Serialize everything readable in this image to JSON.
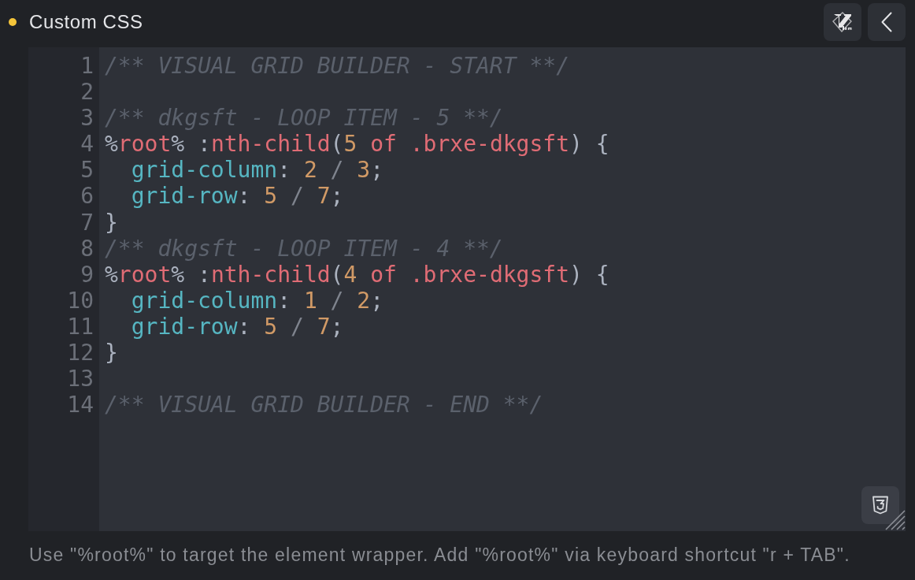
{
  "panel": {
    "title": "Custom CSS",
    "modified": true
  },
  "editor": {
    "lines": [
      {
        "number": "1",
        "tokens": [
          {
            "kind": "comment",
            "text": "/** VISUAL GRID BUILDER - START **/"
          }
        ]
      },
      {
        "number": "2"
      },
      {
        "number": "3",
        "tokens": [
          {
            "kind": "comment",
            "text": "/** dkgsft - LOOP ITEM - 5 **/"
          }
        ]
      },
      {
        "number": "4",
        "tokens": [
          {
            "kind": "plain",
            "text": "%"
          },
          {
            "kind": "keyword",
            "text": "root"
          },
          {
            "kind": "plain",
            "text": "% :"
          },
          {
            "kind": "keyword",
            "text": "nth-child"
          },
          {
            "kind": "plain",
            "text": "("
          },
          {
            "kind": "number",
            "text": "5"
          },
          {
            "kind": "keyword",
            "text": " of .brxe-dkgsft"
          },
          {
            "kind": "plain",
            "text": ") {"
          }
        ]
      },
      {
        "number": "5",
        "tokens": [
          {
            "kind": "property",
            "text": "  grid-column"
          },
          {
            "kind": "plain",
            "text": ": "
          },
          {
            "kind": "number",
            "text": "2"
          },
          {
            "kind": "operator",
            "text": " / "
          },
          {
            "kind": "number",
            "text": "3"
          },
          {
            "kind": "plain",
            "text": ";"
          }
        ]
      },
      {
        "number": "6",
        "tokens": [
          {
            "kind": "property",
            "text": "  grid-row"
          },
          {
            "kind": "plain",
            "text": ": "
          },
          {
            "kind": "number",
            "text": "5"
          },
          {
            "kind": "operator",
            "text": " / "
          },
          {
            "kind": "number",
            "text": "7"
          },
          {
            "kind": "plain",
            "text": ";"
          }
        ]
      },
      {
        "number": "7",
        "tokens": [
          {
            "kind": "plain",
            "text": "}"
          }
        ]
      },
      {
        "number": "8",
        "tokens": [
          {
            "kind": "comment",
            "text": "/** dkgsft - LOOP ITEM - 4 **/"
          }
        ]
      },
      {
        "number": "9",
        "tokens": [
          {
            "kind": "plain",
            "text": "%"
          },
          {
            "kind": "keyword",
            "text": "root"
          },
          {
            "kind": "plain",
            "text": "% :"
          },
          {
            "kind": "keyword",
            "text": "nth-child"
          },
          {
            "kind": "plain",
            "text": "("
          },
          {
            "kind": "number",
            "text": "4"
          },
          {
            "kind": "keyword",
            "text": " of .brxe-dkgsft"
          },
          {
            "kind": "plain",
            "text": ") {"
          }
        ]
      },
      {
        "number": "10",
        "tokens": [
          {
            "kind": "property",
            "text": "  grid-column"
          },
          {
            "kind": "plain",
            "text": ": "
          },
          {
            "kind": "number",
            "text": "1"
          },
          {
            "kind": "operator",
            "text": " / "
          },
          {
            "kind": "number",
            "text": "2"
          },
          {
            "kind": "plain",
            "text": ";"
          }
        ]
      },
      {
        "number": "11",
        "tokens": [
          {
            "kind": "property",
            "text": "  grid-row"
          },
          {
            "kind": "plain",
            "text": ": "
          },
          {
            "kind": "number",
            "text": "5"
          },
          {
            "kind": "operator",
            "text": " / "
          },
          {
            "kind": "number",
            "text": "7"
          },
          {
            "kind": "plain",
            "text": ";"
          }
        ]
      },
      {
        "number": "12",
        "tokens": [
          {
            "kind": "plain",
            "text": "}"
          }
        ]
      },
      {
        "number": "13"
      },
      {
        "number": "14",
        "tokens": [
          {
            "kind": "comment",
            "text": "/** VISUAL GRID BUILDER - END **/"
          }
        ]
      }
    ]
  },
  "hint": "Use \"%root%\" to target the element wrapper. Add \"%root%\" via keyboard shortcut \"r + TAB\"."
}
